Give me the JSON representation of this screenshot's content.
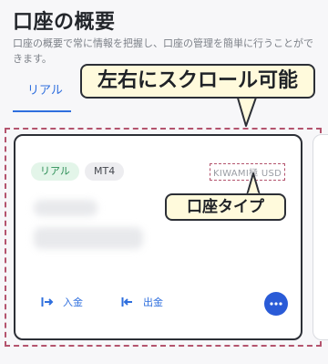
{
  "header": {
    "title": "口座の概要",
    "description": "口座の概要で常に情報を把握し、口座の管理を簡単に行うことができます。"
  },
  "tabs": [
    {
      "label": "リアル"
    }
  ],
  "card": {
    "badges": [
      "リアル",
      "MT4"
    ],
    "account_type": "KIWAMI極 USD",
    "actions": {
      "deposit": "入金",
      "withdraw": "出金"
    }
  },
  "annotations": {
    "scroll_hint": "左右にスクロール可能",
    "account_type_label": "口座タイプ"
  },
  "colors": {
    "accent": "#2f6fde",
    "badge_real_bg": "#e3f5e9",
    "badge_real_text": "#2c8e56",
    "callout_bg": "#fffadc",
    "dashed_border": "#b4546e"
  }
}
